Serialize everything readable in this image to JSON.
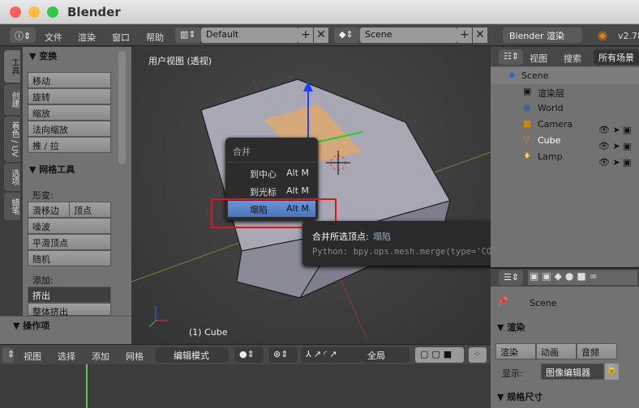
{
  "window": {
    "title": "Blender",
    "colors": {
      "close": "#fc605b",
      "minimize": "#fdbc40",
      "zoom": "#34c84a"
    }
  },
  "header": {
    "menus": [
      "文件",
      "渲染",
      "窗口",
      "帮助"
    ],
    "layout": "Default",
    "scene": "Scene",
    "engine": "Blender 渲染",
    "version": "v2.78"
  },
  "tool_tabs": [
    "工具",
    "创建",
    "着色 / UV",
    "选项",
    "蜡笔"
  ],
  "toolshelf": {
    "transform_title": "▼ 变换",
    "transform_buttons": [
      "移动",
      "旋转",
      "缩放",
      "法向缩放",
      "推 / 拉"
    ],
    "mesh_tools_title": "▼ 网格工具",
    "deform_label": "形变:",
    "slide_edge": "滑移边",
    "vertex": "顶点",
    "deform_buttons": [
      "噪波",
      "平滑顶点",
      "随机"
    ],
    "add_label": "添加:",
    "extrude": "挤出",
    "extrude_all": "整体挤出",
    "operator_title": "▼ 操作项"
  },
  "viewport": {
    "view_label": "用户视图 (透视)",
    "object_label": "(1) Cube"
  },
  "merge_menu": {
    "title": "合并",
    "items": [
      {
        "label": "到中心",
        "shortcut": "Alt M"
      },
      {
        "label": "到光标",
        "shortcut": "Alt M"
      },
      {
        "label": "塌陷",
        "shortcut": "Alt M",
        "selected": true
      }
    ],
    "highlight_color": "#5680c2"
  },
  "tooltip": {
    "title": "合并所选顶点:",
    "value": "塌陷",
    "python": "Python: bpy.ops.mesh.merge(type='COLLAPSE')"
  },
  "outliner": {
    "view": "视图",
    "search": "搜索",
    "filter": "所有场景",
    "items": [
      {
        "label": "Scene"
      },
      {
        "label": "渲染层"
      },
      {
        "label": "World"
      },
      {
        "label": "Camera"
      },
      {
        "label": "Cube"
      },
      {
        "label": "Lamp"
      }
    ]
  },
  "properties": {
    "scene": "Scene",
    "render_title": "▼ 渲染",
    "render_btn": "渲染",
    "anim_btn": "动画",
    "audio_btn": "音频",
    "display_label": "显示:",
    "display_value": "图像编辑器",
    "dims_title": "▼ 规格尺寸"
  },
  "bottom_header": {
    "menus": [
      "视图",
      "选择",
      "添加",
      "网格"
    ],
    "mode": "编辑模式",
    "orientation": "全局"
  }
}
